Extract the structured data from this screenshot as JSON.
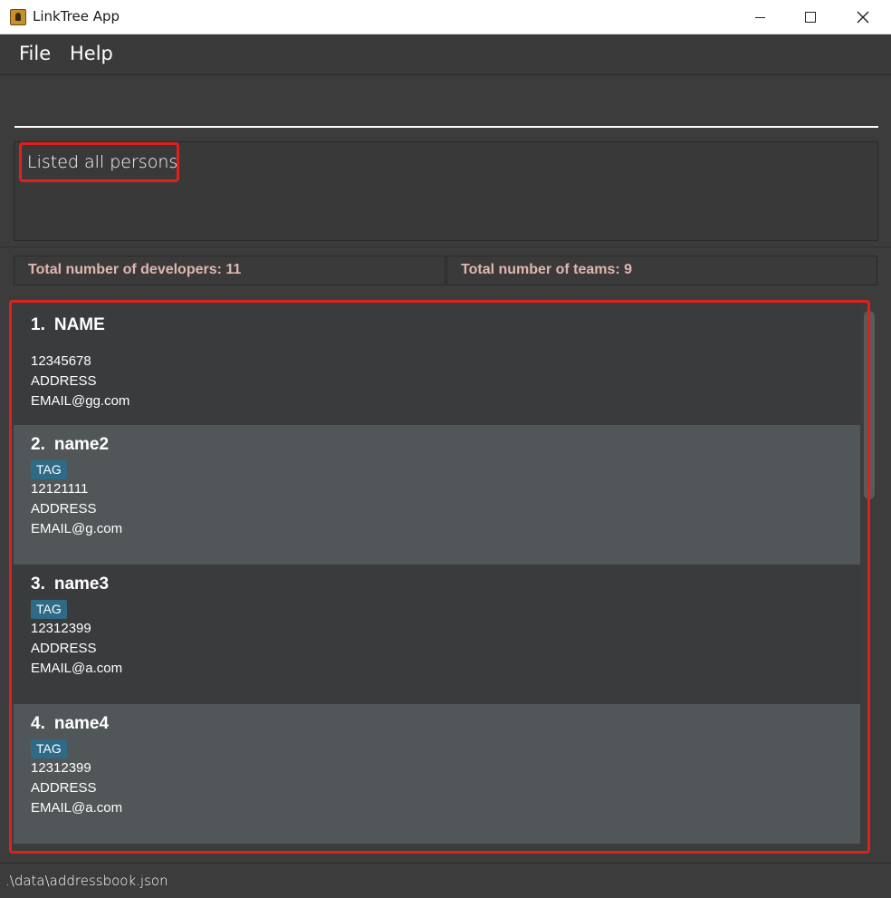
{
  "window": {
    "title": "LinkTree App",
    "minimize_icon": "minimize-icon",
    "maximize_icon": "maximize-icon",
    "close_icon": "close-icon"
  },
  "menu": {
    "file": "File",
    "help": "Help"
  },
  "command": {
    "value": ""
  },
  "result": {
    "message": "Listed all persons"
  },
  "stats": {
    "developers": "Total number of developers: 11",
    "teams": "Total number of teams: 9"
  },
  "persons": [
    {
      "index": "1.",
      "name": "NAME",
      "tag": "",
      "phone": "12345678",
      "address": "ADDRESS",
      "email": "EMAIL@gg.com"
    },
    {
      "index": "2.",
      "name": "name2",
      "tag": "TAG",
      "phone": "12121111",
      "address": "ADDRESS",
      "email": "EMAIL@g.com"
    },
    {
      "index": "3.",
      "name": "name3",
      "tag": "TAG",
      "phone": "12312399",
      "address": "ADDRESS",
      "email": "EMAIL@a.com"
    },
    {
      "index": "4.",
      "name": "name4",
      "tag": "TAG",
      "phone": "12312399",
      "address": "ADDRESS",
      "email": "EMAIL@a.com"
    }
  ],
  "status": {
    "path": ".\\data\\addressbook.json"
  },
  "colors": {
    "highlight": "#e0201c",
    "tag": "#2f6a87",
    "stat_text": "#e0b6b0"
  }
}
